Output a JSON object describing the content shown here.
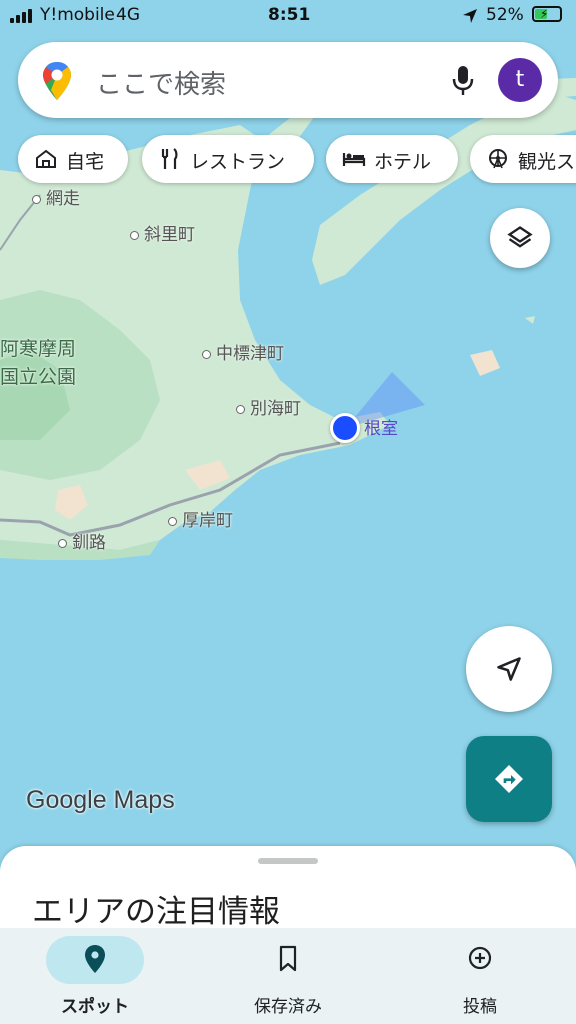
{
  "status_bar": {
    "carrier": "Y!mobile",
    "network": "4G",
    "time": "8:51",
    "battery_pct": "52%",
    "battery_level": 0.52
  },
  "search": {
    "placeholder": "ここで検索",
    "avatar_letter": "t"
  },
  "chips": [
    {
      "label": "自宅",
      "icon": "home-icon"
    },
    {
      "label": "レストラン",
      "icon": "restaurant-icon"
    },
    {
      "label": "ホテル",
      "icon": "hotel-icon"
    },
    {
      "label": "観光ス",
      "icon": "ferris-wheel-icon"
    }
  ],
  "map": {
    "labels": {
      "abashiri": "網走",
      "shari": "斜里町",
      "akan_1": "阿寒摩周",
      "akan_2": "国立公園",
      "nakashibetsu": "中標津町",
      "betsukai": "別海町",
      "nemuro": "根室",
      "akkeshi": "厚岸町",
      "kushiro": "釧路"
    },
    "colors": {
      "water": "#8fd3ea",
      "land": "#cfe9d4",
      "land_dark": "#b6dfbf",
      "location": "#1a4dff"
    }
  },
  "logo": "Google Maps",
  "sheet": {
    "title": "エリアの注目情報"
  },
  "nav": [
    {
      "label": "スポット",
      "icon": "explore-pin-icon",
      "active": true
    },
    {
      "label": "保存済み",
      "icon": "bookmark-icon",
      "active": false
    },
    {
      "label": "投稿",
      "icon": "add-circle-icon",
      "active": false
    }
  ],
  "accent": "#0d7f85"
}
